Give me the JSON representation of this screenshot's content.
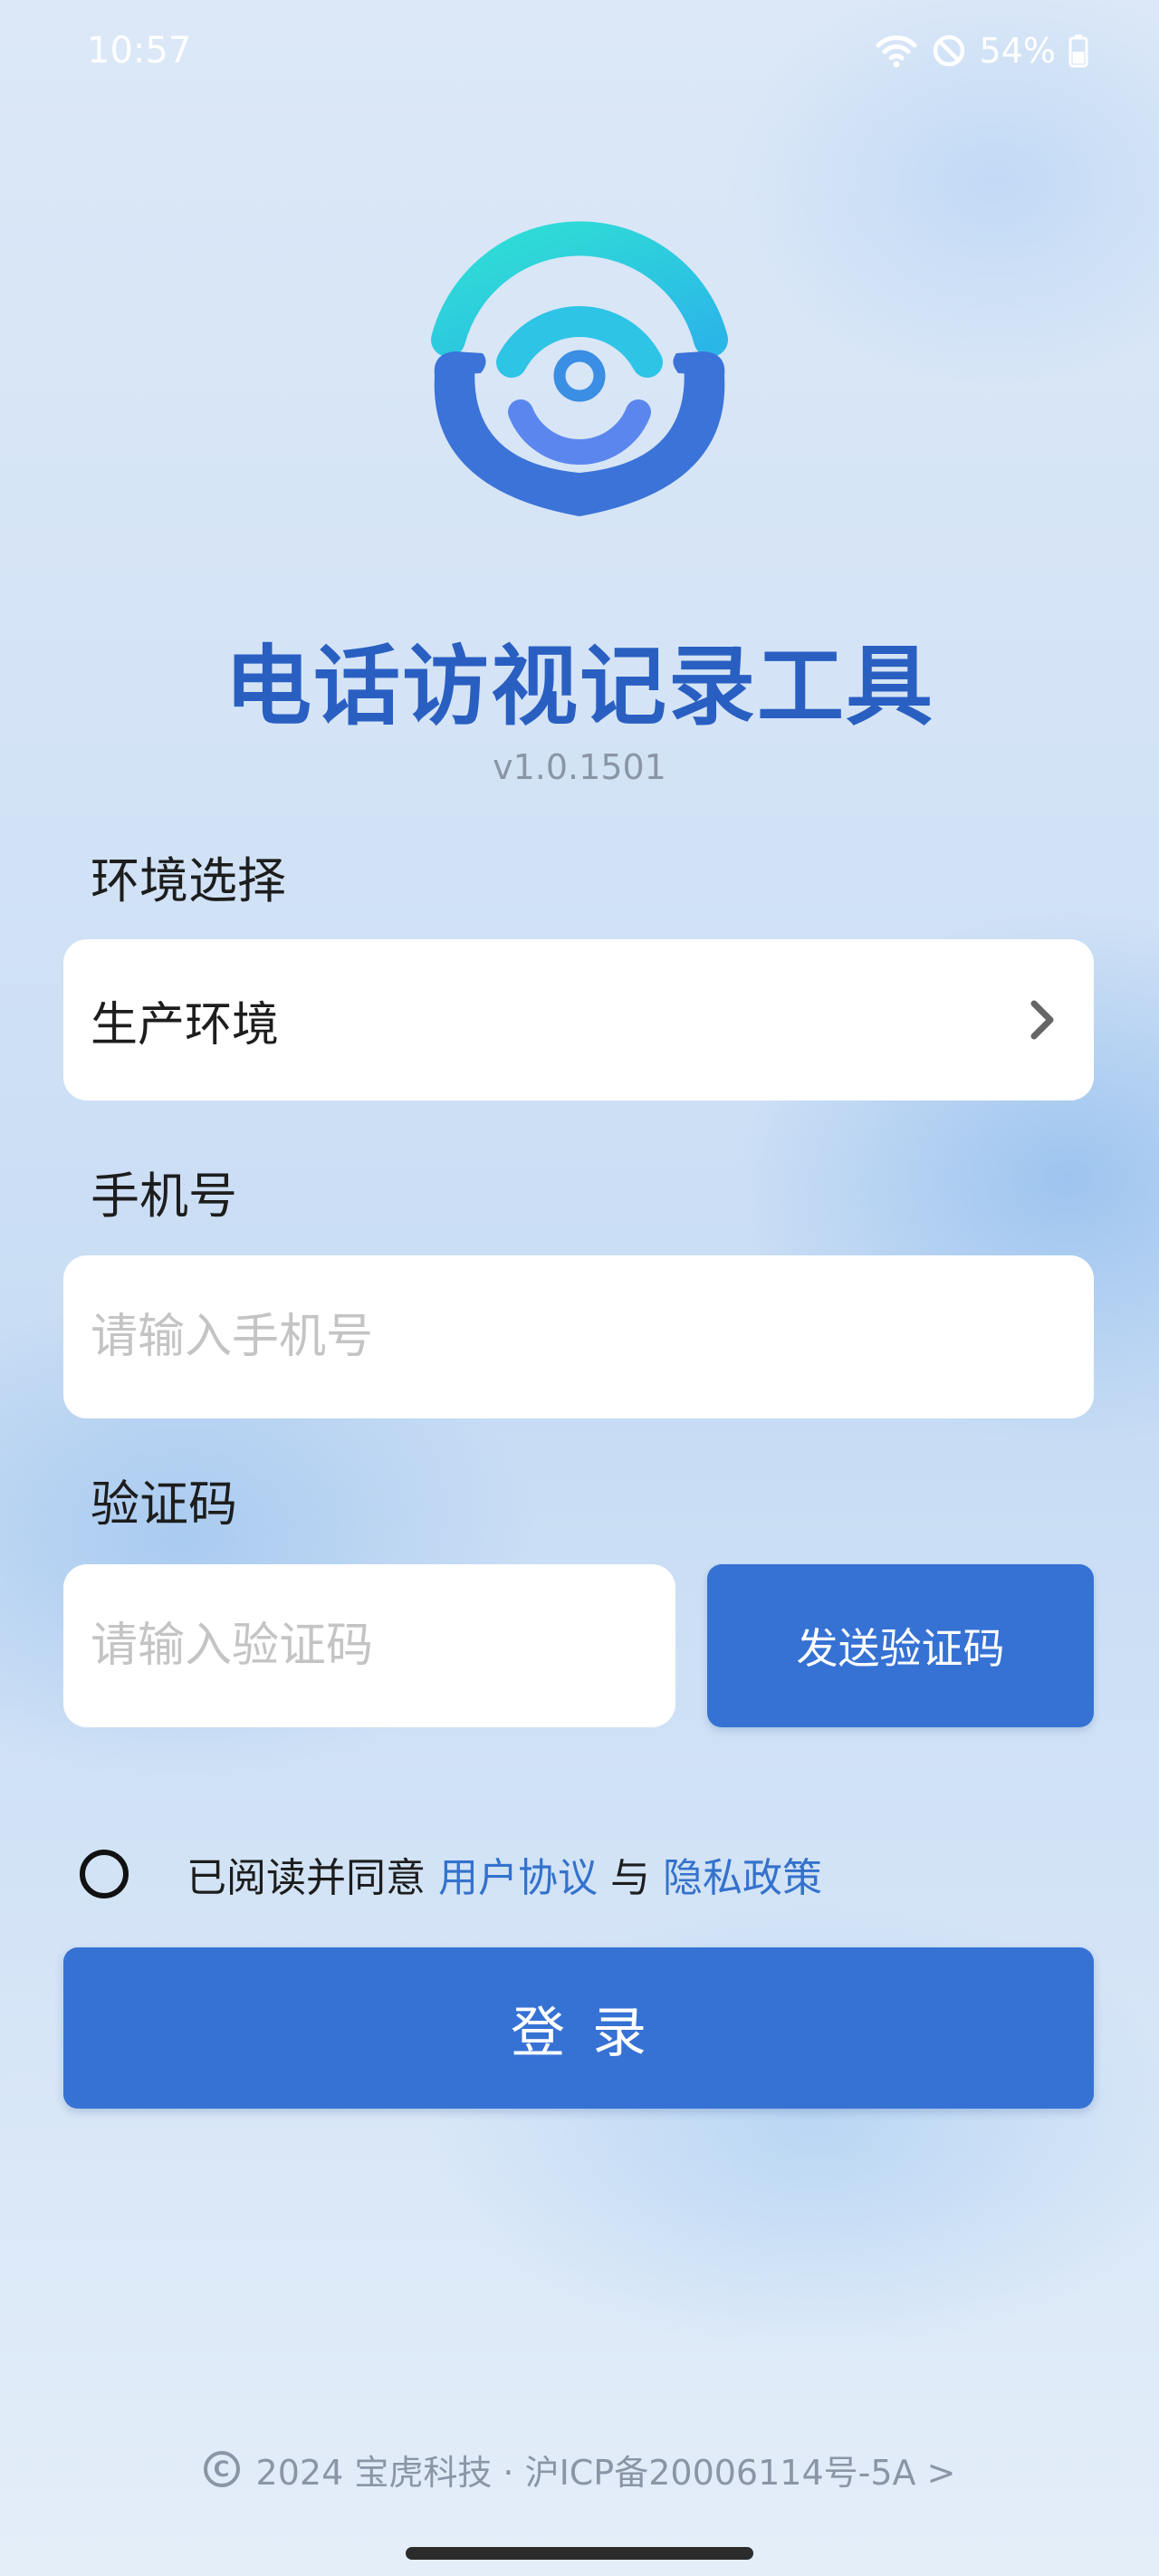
{
  "status_bar": {
    "time": "10:57",
    "battery": "54%",
    "icons": [
      "wifi-icon",
      "do-not-disturb-icon",
      "battery-icon"
    ]
  },
  "app": {
    "title": "电话访视记录工具",
    "version": "v1.0.1501"
  },
  "environment": {
    "label": "环境选择",
    "value": "生产环境"
  },
  "phone": {
    "label": "手机号",
    "placeholder": "请输入手机号",
    "value": ""
  },
  "code": {
    "label": "验证码",
    "placeholder": "请输入验证码",
    "value": "",
    "send_label": "发送验证码"
  },
  "agreement": {
    "prefix": "已阅读并同意",
    "user_agreement": "用户协议",
    "conjunction": "与",
    "privacy_policy": "隐私政策",
    "checked": false
  },
  "login_label": "登录",
  "footer": {
    "text": "2024 宝虎科技 · 沪ICP备20006114号-5A >"
  },
  "colors": {
    "primary": "#3672d4",
    "title": "#2a5fc2",
    "link": "#3472cc"
  }
}
